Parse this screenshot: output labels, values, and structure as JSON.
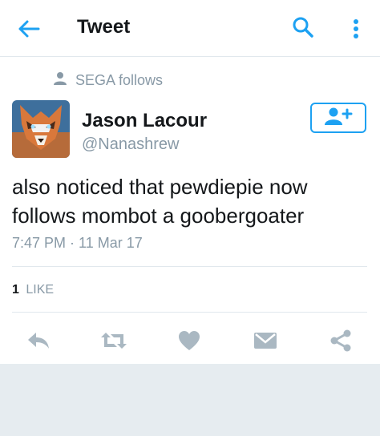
{
  "header": {
    "title": "Tweet",
    "back_icon": "arrow-left-icon",
    "search_icon": "search-icon",
    "more_icon": "more-vertical-icon"
  },
  "social_context": {
    "text": "SEGA follows",
    "icon": "person-icon"
  },
  "author": {
    "name": "Jason Lacour",
    "handle": "@Nanashrew",
    "avatar_icon": "fox-avatar"
  },
  "follow_button": {
    "icon": "add-user-icon"
  },
  "tweet": {
    "text": "also noticed that pewdiepie now follows mombot a goobergoater",
    "timestamp": "7:47 PM · 11 Mar 17"
  },
  "stats": {
    "likes_count": "1",
    "likes_label": "LIKE"
  },
  "actions": [
    {
      "name": "reply",
      "icon": "reply-icon"
    },
    {
      "name": "retweet",
      "icon": "retweet-icon"
    },
    {
      "name": "like",
      "icon": "heart-icon"
    },
    {
      "name": "message",
      "icon": "envelope-icon"
    },
    {
      "name": "share",
      "icon": "share-icon"
    }
  ],
  "colors": {
    "accent": "#1da1f2",
    "secondary_text": "#8899a6",
    "action_icon": "#aab8c2",
    "background": "#e6ecf0"
  }
}
